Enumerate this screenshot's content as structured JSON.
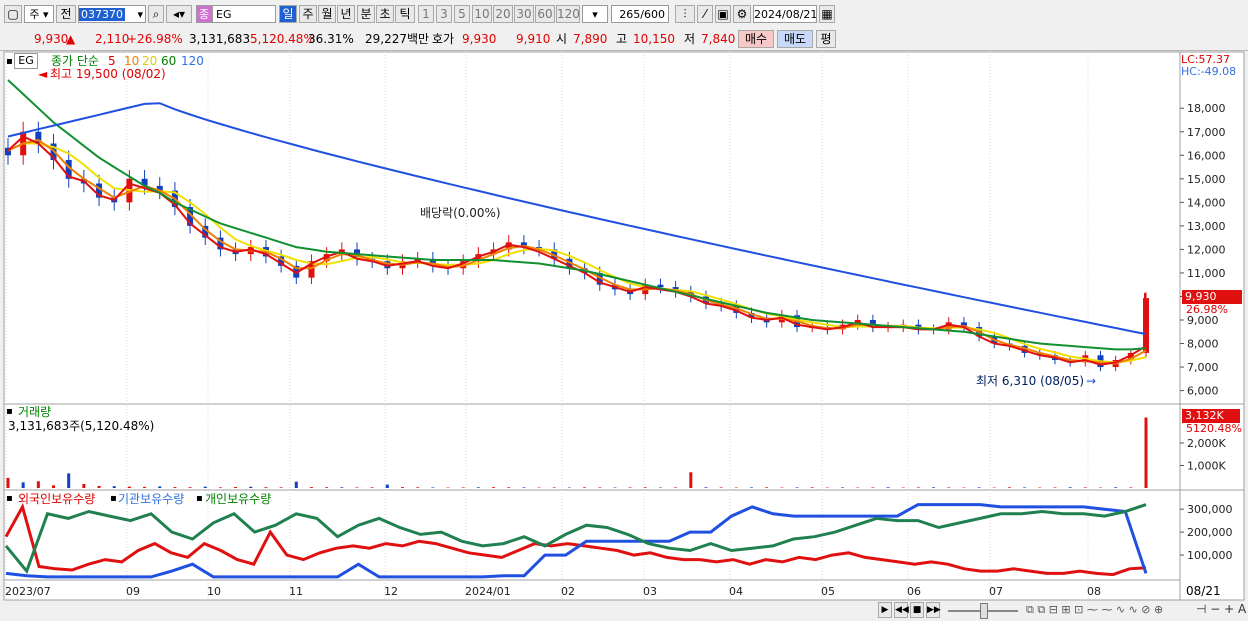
{
  "toolbar": {
    "tab_week": "주",
    "tab_prev": "전",
    "code": "037370",
    "name": "EG",
    "name_badge": "종",
    "periods": [
      "일",
      "주",
      "월",
      "년",
      "분",
      "초",
      "틱"
    ],
    "minutes": [
      "1",
      "3",
      "5",
      "10",
      "20",
      "30",
      "60",
      "120"
    ],
    "count": "265",
    "count_total": "/600",
    "date": "2024/08/21"
  },
  "quote": {
    "price": "9,930",
    "arrow": "▲",
    "change": "2,110",
    "change_pct": "+26.98%",
    "volume": "3,131,683",
    "volume_ratio": "5,120.48%",
    "turnover": "36.31%",
    "amount": "29,227백만",
    "bid_label": "호가",
    "ask": "9,930",
    "bid": "9,910",
    "open_label": "시",
    "open": "7,890",
    "high_label": "고",
    "high": "10,150",
    "low_label": "저",
    "low": "7,840",
    "buy_label": "매수",
    "sell_label": "매도",
    "avg_label": "평"
  },
  "legend": {
    "code": "EG",
    "ma_label": "종가 단순",
    "ma_periods": [
      "5",
      "10",
      "20",
      "60",
      "120"
    ],
    "ma_colors": [
      "#e01010",
      "#f08000",
      "#f0e000",
      "#109030",
      "#2050e0"
    ],
    "high_note": "최고 19,500 (08/02)",
    "low_note": "최저 6,310 (08/05)",
    "dividend_note": "배당락(0.00%)",
    "lc": "LC:57.37",
    "hc": "HC:-49.08",
    "price_tag": "9,930",
    "pct_tag": "26.98%"
  },
  "volume_panel": {
    "title": "거래량",
    "value_label": "3,131,683주(5,120.48%)",
    "tag": "3,132K",
    "tag_pct": "5120.48%"
  },
  "holding_panel": {
    "labels": [
      "외국인보유수량",
      "기관보유수량",
      "개인보유수량"
    ],
    "colors": [
      "#e01010",
      "#2050e0",
      "#208050"
    ]
  },
  "date_label": "08/21",
  "chart_data": [
    {
      "type": "candlestick",
      "title": "EG",
      "y_ticks": [
        6000,
        7000,
        8000,
        9000,
        10000,
        11000,
        12000,
        13000,
        14000,
        15000,
        16000,
        17000,
        18000
      ],
      "y_tick_labels": [
        "6,000",
        "7,000",
        "8,000",
        "9,000",
        "10,000",
        "11,000",
        "12,000",
        "13,000",
        "14,000",
        "15,000",
        "16,000",
        "17,000",
        "18,000"
      ],
      "x_tick_labels": [
        "2023/07",
        "09",
        "10",
        "11",
        "12",
        "2024/01",
        "02",
        "03",
        "04",
        "05",
        "06",
        "07",
        "08"
      ],
      "close": [
        16000,
        17000,
        16500,
        15800,
        15000,
        14800,
        14200,
        14000,
        15000,
        14700,
        14500,
        13800,
        13000,
        12500,
        12000,
        11800,
        12100,
        11700,
        11300,
        10800,
        11500,
        11800,
        12000,
        11600,
        11500,
        11200,
        11500,
        11600,
        11300,
        11200,
        11500,
        11800,
        12000,
        12300,
        12100,
        12000,
        11600,
        11200,
        11000,
        10500,
        10300,
        10100,
        10500,
        10400,
        10200,
        10000,
        9700,
        9600,
        9300,
        9100,
        8900,
        9200,
        8700,
        8700,
        8600,
        8800,
        9000,
        8700,
        8700,
        8800,
        8600,
        8600,
        8900,
        8700,
        8300,
        8000,
        7900,
        7600,
        7500,
        7300,
        7200,
        7500,
        7000,
        7300,
        7600,
        9930
      ],
      "ma_values": {
        "5": [
          16200,
          16800,
          16500,
          15900,
          15100,
          14900,
          14300,
          14100,
          14800,
          14600,
          14400,
          13900,
          13100,
          12600,
          12100,
          11900,
          12000,
          11800,
          11400,
          11000,
          11400,
          11700,
          11900,
          11600,
          11500,
          11300,
          11400,
          11500,
          11300,
          11200,
          11400,
          11700,
          11900,
          12200,
          12100,
          11900,
          11600,
          11300,
          11000,
          10600,
          10400,
          10200,
          10400,
          10300,
          10200,
          10000,
          9700,
          9600,
          9400,
          9100,
          9000,
          9100,
          8800,
          8700,
          8600,
          8700,
          8900,
          8700,
          8700,
          8700,
          8600,
          8600,
          8800,
          8700,
          8300,
          8000,
          7900,
          7700,
          7500,
          7400,
          7200,
          7300,
          7100,
          7200,
          7500,
          7900
        ],
        "60": [
          19200,
          18600,
          18000,
          17400,
          16900,
          16400,
          15900,
          15500,
          15100,
          14700,
          14400,
          14000,
          13700,
          13400,
          13100,
          12900,
          12700,
          12500,
          12300,
          12100,
          12000,
          11900,
          11850,
          11800,
          11750,
          11700,
          11650,
          11600,
          11550,
          11550,
          11550,
          11550,
          11550,
          11500,
          11450,
          11400,
          11300,
          11200,
          11100,
          10950,
          10800,
          10650,
          10500,
          10350,
          10200,
          10050,
          9900,
          9750,
          9600,
          9450,
          9300,
          9200,
          9100,
          9000,
          8950,
          8900,
          8850,
          8800,
          8750,
          8700,
          8650,
          8600,
          8550,
          8500,
          8400,
          8300,
          8200,
          8100,
          8000,
          7950,
          7900,
          7850,
          7800,
          7750,
          7750,
          7800
        ]
      },
      "high": 19500,
      "low": 6310,
      "last": 9930
    },
    {
      "type": "bar",
      "title": "거래량",
      "y_tick_labels": [
        "1,000K",
        "2,000K"
      ],
      "ylim": [
        0,
        3200
      ],
      "values": [
        450,
        250,
        300,
        120,
        650,
        180,
        90,
        80,
        60,
        50,
        70,
        40,
        35,
        60,
        30,
        45,
        55,
        35,
        30,
        280,
        40,
        35,
        30,
        25,
        30,
        150,
        40,
        30,
        25,
        20,
        25,
        30,
        35,
        30,
        25,
        20,
        25,
        20,
        30,
        25,
        20,
        25,
        30,
        20,
        25,
        700,
        30,
        25,
        20,
        25,
        30,
        20,
        25,
        30,
        20,
        25,
        20,
        25,
        30,
        20,
        25,
        30,
        25,
        20,
        25,
        20,
        30,
        25,
        20,
        25,
        30,
        25,
        20,
        30,
        25,
        3132
      ]
    },
    {
      "type": "line",
      "title": "외국인보유수량 / 기관보유수량 / 개인보유수량",
      "y_tick_labels": [
        "100,000",
        "200,000",
        "300,000"
      ],
      "ylim": [
        0,
        340000
      ],
      "series": [
        {
          "name": "외국인보유수량",
          "values": [
            180000,
            310000,
            50000,
            40000,
            35000,
            60000,
            80000,
            70000,
            120000,
            150000,
            110000,
            90000,
            150000,
            120000,
            80000,
            60000,
            200000,
            100000,
            80000,
            110000,
            130000,
            140000,
            130000,
            150000,
            140000,
            160000,
            150000,
            130000,
            110000,
            100000,
            90000,
            120000,
            150000,
            140000,
            150000,
            140000,
            130000,
            120000,
            100000,
            110000,
            90000,
            80000,
            80000,
            70000,
            80000,
            60000,
            80000,
            70000,
            90000,
            80000,
            100000,
            110000,
            90000,
            80000,
            70000,
            60000,
            70000,
            60000,
            40000,
            30000,
            30000,
            40000,
            30000,
            20000,
            20000,
            30000,
            20000,
            15000,
            40000,
            45000
          ]
        },
        {
          "name": "기관보유수량",
          "values": [
            20000,
            10000,
            5000,
            5000,
            5000,
            5000,
            5000,
            5000,
            30000,
            60000,
            5000,
            5000,
            5000,
            5000,
            5000,
            5000,
            5000,
            60000,
            5000,
            5000,
            5000,
            5000,
            5000,
            5000,
            10000,
            10000,
            100000,
            100000,
            160000,
            160000,
            160000,
            160000,
            160000,
            200000,
            200000,
            270000,
            310000,
            280000,
            270000,
            270000,
            270000,
            270000,
            270000,
            270000,
            320000,
            320000,
            320000,
            320000,
            310000,
            310000,
            310000,
            310000,
            310000,
            300000,
            290000,
            20000
          ]
        },
        {
          "name": "개인보유수량",
          "values": [
            140000,
            30000,
            280000,
            260000,
            290000,
            270000,
            250000,
            280000,
            200000,
            170000,
            240000,
            280000,
            200000,
            230000,
            280000,
            260000,
            180000,
            230000,
            260000,
            220000,
            190000,
            200000,
            160000,
            140000,
            150000,
            180000,
            140000,
            190000,
            230000,
            220000,
            190000,
            150000,
            130000,
            120000,
            150000,
            120000,
            130000,
            140000,
            170000,
            180000,
            200000,
            230000,
            260000,
            250000,
            250000,
            220000,
            240000,
            260000,
            280000,
            280000,
            290000,
            280000,
            280000,
            270000,
            290000,
            320000
          ]
        }
      ]
    }
  ]
}
